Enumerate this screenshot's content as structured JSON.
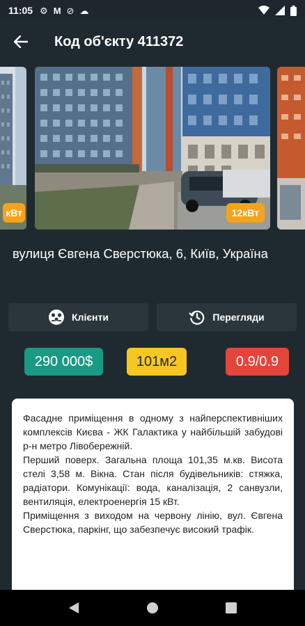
{
  "status_bar": {
    "time": "11:05"
  },
  "app_bar": {
    "title": "Код об'єкту 411372"
  },
  "photos": [
    {
      "badge": "кВт"
    },
    {
      "badge": "12кВт"
    }
  ],
  "address": "вулиця Євгена Сверстюка, 6, Київ, Україна",
  "actions": {
    "clients_label": "Клієнти",
    "views_label": "Перегляди"
  },
  "chips": {
    "price": "290 000$",
    "area": "101м2",
    "ratio": "0.9/0.9"
  },
  "description": {
    "p1": "Фасадне приміщення в одному з найперспективніших комплексів Києва - ЖК Галактика у найбільшій забудові р-н метро Лівобережній.",
    "p2": "Перший поверх. Загальна площа 101,35 м.кв. Висота стелі 3,58 м. Вікна. Стан після будівельників: стяжка, радіатори. Комунікації: вода, каналізація, 2 санвузли, вентиляція, електроенергія 15 кВт.",
    "p3": "Приміщення з виходом на червону лінію, вул. Євгена Сверстюка, паркінг, що забезпечує високий трафік."
  },
  "colors": {
    "background": "#1f2a30",
    "price_chip": "#1a9a84",
    "area_chip": "#f7c623",
    "ratio_chip": "#e4453a",
    "badge": "#f5a31a"
  }
}
